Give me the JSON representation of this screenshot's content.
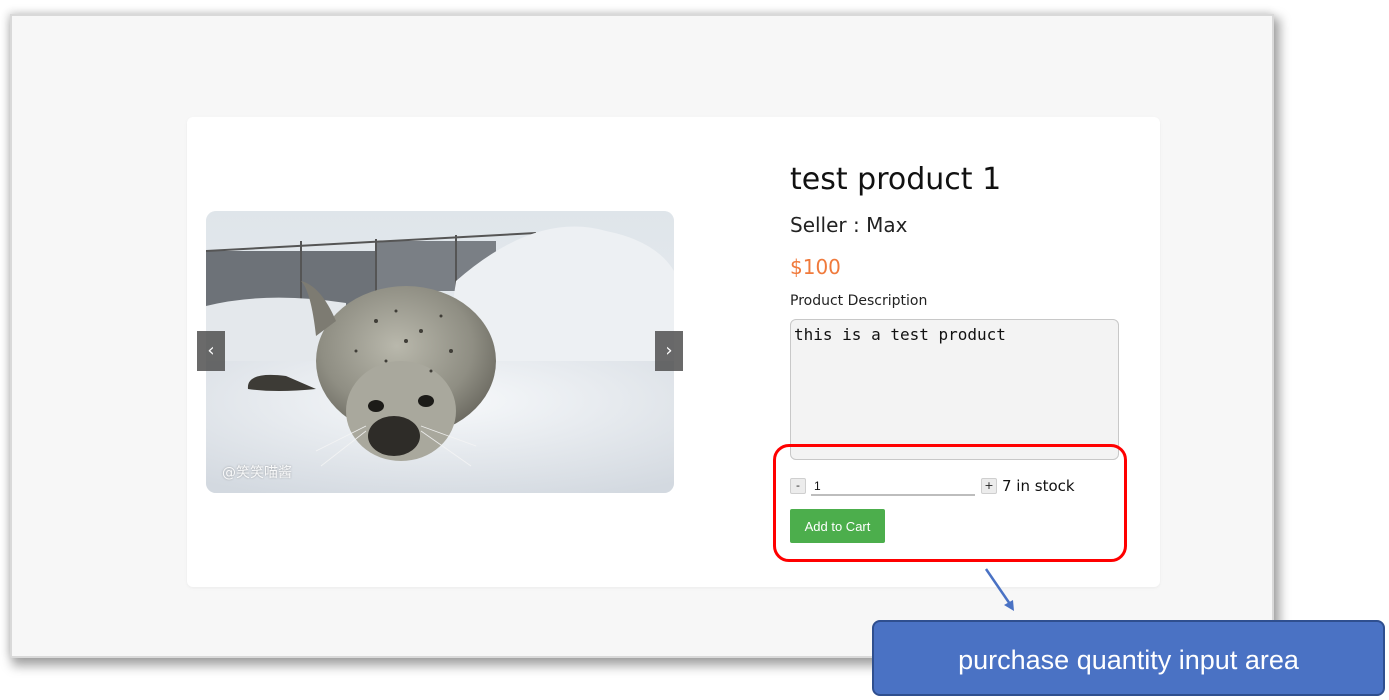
{
  "product": {
    "title": "test product 1",
    "seller": "Seller : Max",
    "price": "$100",
    "description_label": "Product Description",
    "description": "this is a test product"
  },
  "carousel": {
    "prev_glyph": "‹",
    "next_glyph": "›",
    "watermark": "@笑笑喵酱",
    "image_subject": "seal lying on snow"
  },
  "purchase": {
    "minus_label": "-",
    "plus_label": "+",
    "quantity": "1",
    "stock": "7 in stock",
    "add_to_cart": "Add to Cart"
  },
  "annotation": {
    "callout_text": "purchase quantity input area",
    "highlight_color": "#ff0000",
    "callout_color": "#4a72c4"
  },
  "colors": {
    "price": "#f07a3c",
    "button": "#4cae4c"
  }
}
